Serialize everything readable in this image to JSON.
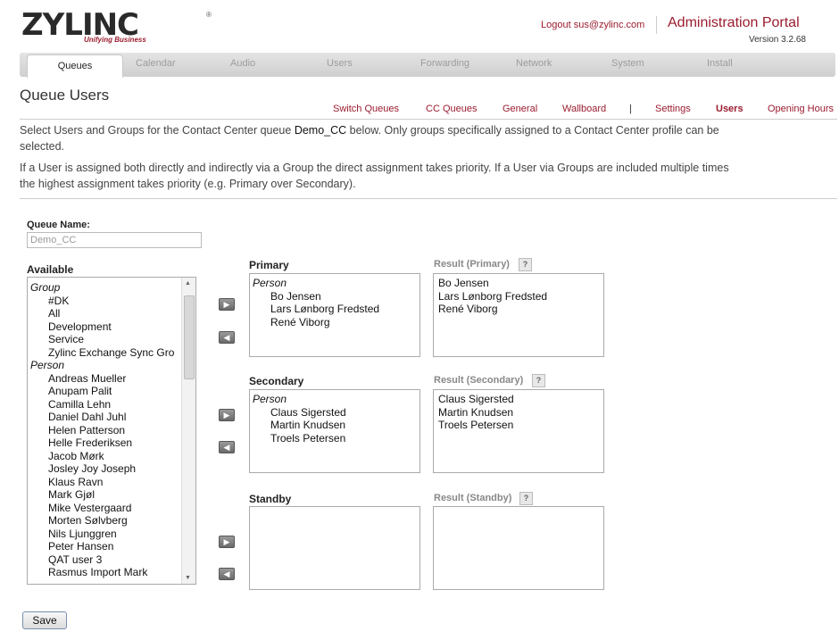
{
  "header": {
    "logo_text": "ZYLINC",
    "logo_tagline": "Unifying Business",
    "logout_label": "Logout sus@zylinc.com",
    "portal_title": "Administration Portal",
    "version": "Version 3.2.68"
  },
  "tabs": [
    {
      "label": "Queues",
      "active": true
    },
    {
      "label": "Calendar"
    },
    {
      "label": "Audio"
    },
    {
      "label": "Users"
    },
    {
      "label": "Forwarding"
    },
    {
      "label": "Network"
    },
    {
      "label": "System"
    },
    {
      "label": "Install"
    }
  ],
  "page_title": "Queue Users",
  "sublinks": [
    {
      "label": "Switch Queues"
    },
    {
      "label": "CC Queues"
    },
    {
      "label": "General"
    },
    {
      "label": "Wallboard"
    },
    {
      "label": "|"
    },
    {
      "label": "Settings"
    },
    {
      "label": "Users",
      "active": true
    },
    {
      "label": "Opening Hours"
    }
  ],
  "description": {
    "line1_pre": "Select Users and Groups for the Contact Center queue ",
    "queue": "Demo_CC",
    "line1_post": " below. Only groups specifically assigned to a Contact Center profile can be",
    "line2": "selected.",
    "line3": "If a User is assigned both directly and indirectly via a Group the direct assignment takes priority. If a User via Groups are included multiple times",
    "line4": "the highest assignment takes priority (e.g. Primary over Secondary)."
  },
  "queue_name": {
    "label": "Queue Name:",
    "value": "Demo_CC"
  },
  "available": {
    "label": "Available",
    "group_header": "Group",
    "groups": [
      "#DK",
      "All",
      "Development",
      "Service",
      "Zylinc Exchange Sync Gro"
    ],
    "person_header": "Person",
    "persons": [
      "Andreas Mueller",
      "Anupam Palit",
      "Camilla Lehn",
      "Daniel Dahl Juhl",
      "Helen Patterson",
      "Helle Frederiksen",
      "Jacob Mørk",
      "Josley Joy Joseph",
      "Klaus Ravn",
      "Mark Gjøl",
      "Mike Vestergaard",
      "Morten Sølvberg",
      "Nils Ljunggren",
      "Peter Hansen",
      "QAT user 3",
      "Rasmus Import Mark"
    ]
  },
  "primary": {
    "label": "Primary",
    "person_header": "Person",
    "persons": [
      "Bo Jensen",
      "Lars Lønborg Fredsted",
      "René Viborg"
    ],
    "result_label": "Result (Primary)",
    "result": [
      "Bo Jensen",
      "Lars Lønborg Fredsted",
      "René Viborg"
    ]
  },
  "secondary": {
    "label": "Secondary",
    "person_header": "Person",
    "persons": [
      "Claus Sigersted",
      "Martin Knudsen",
      "Troels Petersen"
    ],
    "result_label": "Result (Secondary)",
    "result": [
      "Claus Sigersted",
      "Martin Knudsen",
      "Troels Petersen"
    ]
  },
  "standby": {
    "label": "Standby",
    "result_label": "Result (Standby)"
  },
  "help_glyph": "?",
  "add_glyph": "▶",
  "remove_glyph": "◀",
  "save_label": "Save",
  "colors": {
    "accent": "#9a1c2f",
    "tabbar": "#d8d8d8"
  }
}
